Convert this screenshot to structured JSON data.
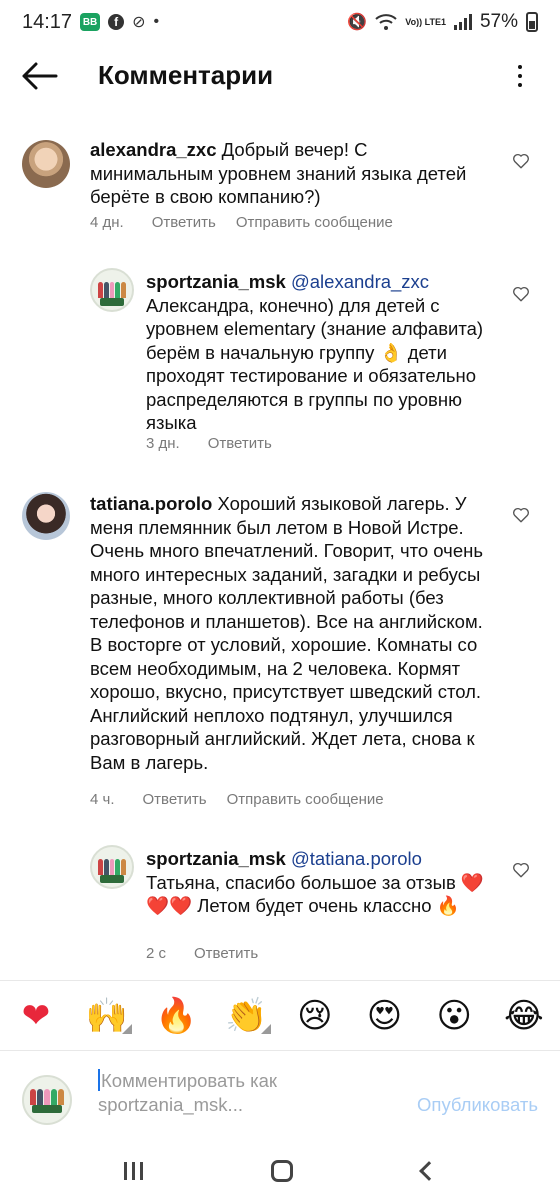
{
  "status_bar": {
    "time": "14:17",
    "badge_vb": "ВВ",
    "badge_fb": "f",
    "network": "Vo)) LTE1",
    "battery": "57%"
  },
  "header": {
    "title": "Комментарии"
  },
  "comments": [
    {
      "username": "alexandra_zxc",
      "text": " Добрый вечер! С минимальным уровнем знаний языка детей берёте в свою компанию?)",
      "time": "4 дн.",
      "reply_label": "Ответить",
      "message_label": "Отправить сообщение"
    },
    {
      "username": "sportzania_msk",
      "mention": "@alexandra_zxc",
      "text": "Александра, конечно) для детей с уровнем elementary (знание алфавита) берём в начальную группу 👌 дети проходят тестирование и обязательно распределяются в группы по уровню языка",
      "time": "3 дн.",
      "reply_label": "Ответить"
    },
    {
      "username": "tatiana.porolo",
      "text": " Хороший языковой лагерь. У меня племянник был летом в Новой Истре. Очень много впечатлений. Говорит, что очень много интересных заданий, загадки и ребусы разные, много коллективной работы (без телефонов и планшетов). Все на английском.  В восторге от условий, хорошие. Комнаты со всем необходимым, на 2 человека. Кормят хорошо, вкусно, присутствует шведский стол.  Английский неплохо подтянул, улучшился разговорный английский. Ждет лета, снова к Вам в лагерь.",
      "time": "4 ч.",
      "reply_label": "Ответить",
      "message_label": "Отправить сообщение"
    },
    {
      "username": "sportzania_msk",
      "mention": "@tatiana.porolo",
      "text": "Татьяна, спасибо большое за отзыв ❤️❤️❤️  Летом будет очень классно 🔥",
      "time": "2 с",
      "reply_label": "Ответить"
    }
  ],
  "emoji_bar": [
    "❤",
    "🙌",
    "🔥",
    "👏",
    "😢",
    "😍",
    "😮",
    "😂"
  ],
  "composer": {
    "placeholder": "Комментировать как sportzania_msk...",
    "publish_label": "Опубликовать"
  },
  "colors": {
    "mention": "#1b3f8f",
    "publish_disabled": "#a9cdf5",
    "meta": "#7a7a7a"
  }
}
